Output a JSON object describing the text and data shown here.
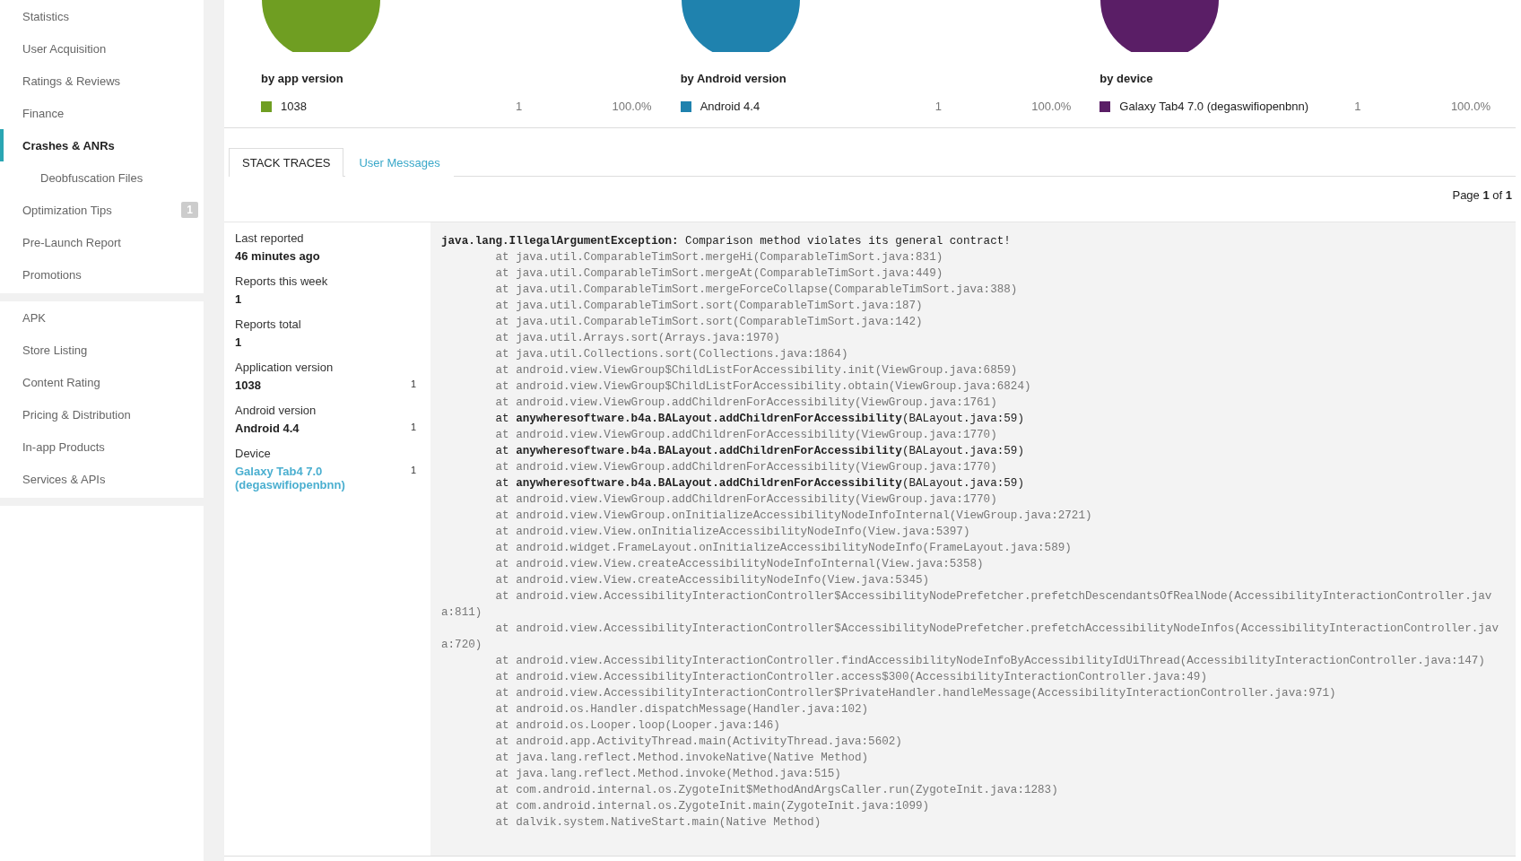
{
  "sidebar": {
    "sections": [
      {
        "items": [
          {
            "label": "Statistics",
            "selected": false
          },
          {
            "label": "User Acquisition",
            "selected": false
          },
          {
            "label": "Ratings & Reviews",
            "selected": false
          },
          {
            "label": "Finance",
            "selected": false
          },
          {
            "label": "Crashes & ANRs",
            "selected": true,
            "children": [
              {
                "label": "Deobfuscation Files",
                "selected": false
              }
            ]
          },
          {
            "label": "Optimization Tips",
            "selected": false,
            "badge": "1"
          },
          {
            "label": "Pre-Launch Report",
            "selected": false
          },
          {
            "label": "Promotions",
            "selected": false
          }
        ]
      },
      {
        "items": [
          {
            "label": "APK",
            "selected": false
          },
          {
            "label": "Store Listing",
            "selected": false
          },
          {
            "label": "Content Rating",
            "selected": false
          },
          {
            "label": "Pricing & Distribution",
            "selected": false
          },
          {
            "label": "In-app Products",
            "selected": false
          },
          {
            "label": "Services & APIs",
            "selected": false
          }
        ]
      }
    ]
  },
  "breakdowns": [
    {
      "title": "by app version",
      "legend": [
        {
          "label": "1038",
          "count": "1",
          "percent": "100.0%",
          "color": "#6f9e22"
        }
      ]
    },
    {
      "title": "by Android version",
      "legend": [
        {
          "label": "Android 4.4",
          "count": "1",
          "percent": "100.0%",
          "color": "#1f82ae"
        }
      ]
    },
    {
      "title": "by device",
      "legend": [
        {
          "label": "Galaxy Tab4 7.0 (degaswifiopenbnn)",
          "count": "1",
          "percent": "100.0%",
          "color": "#5a1e66"
        }
      ]
    }
  ],
  "tabs": [
    {
      "label": "STACK TRACES",
      "selected": true
    },
    {
      "label": "User Messages",
      "selected": false
    }
  ],
  "pagination": "Page **1** of **1**",
  "details": [
    {
      "label": "Last reported",
      "value": "46 minutes ago",
      "kind": "text"
    },
    {
      "label": "Reports this week",
      "value": "1",
      "kind": "text"
    },
    {
      "label": "Reports total",
      "value": "1",
      "kind": "text"
    },
    {
      "label": "Application version",
      "value": "1038",
      "count": "1",
      "kind": "text"
    },
    {
      "label": "Android version",
      "value": "Android 4.4",
      "count": "1",
      "kind": "text"
    },
    {
      "label": "Device",
      "value": "Galaxy Tab4 7.0 (degaswifiopenbnn)",
      "count": "1",
      "kind": "link"
    }
  ],
  "stack_trace": [
    {
      "kind": "exception",
      "text": "**java.lang.IllegalArgumentException:** Comparison method violates its general contract!"
    },
    {
      "kind": "frame",
      "text": "at java.util.ComparableTimSort.mergeHi(ComparableTimSort.java:831)"
    },
    {
      "kind": "frame",
      "text": "at java.util.ComparableTimSort.mergeAt(ComparableTimSort.java:449)"
    },
    {
      "kind": "frame",
      "text": "at java.util.ComparableTimSort.mergeForceCollapse(ComparableTimSort.java:388)"
    },
    {
      "kind": "frame",
      "text": "at java.util.ComparableTimSort.sort(ComparableTimSort.java:187)"
    },
    {
      "kind": "frame",
      "text": "at java.util.ComparableTimSort.sort(ComparableTimSort.java:142)"
    },
    {
      "kind": "frame",
      "text": "at java.util.Arrays.sort(Arrays.java:1970)"
    },
    {
      "kind": "frame",
      "text": "at java.util.Collections.sort(Collections.java:1864)"
    },
    {
      "kind": "frame",
      "text": "at android.view.ViewGroup$ChildListForAccessibility.init(ViewGroup.java:6859)"
    },
    {
      "kind": "frame",
      "text": "at android.view.ViewGroup$ChildListForAccessibility.obtain(ViewGroup.java:6824)"
    },
    {
      "kind": "frame",
      "text": "at android.view.ViewGroup.addChildrenForAccessibility(ViewGroup.java:1761)"
    },
    {
      "kind": "app_frame",
      "text": "at **anywheresoftware.b4a.BALayout.addChildrenForAccessibility**(BALayout.java:59)"
    },
    {
      "kind": "frame",
      "text": "at android.view.ViewGroup.addChildrenForAccessibility(ViewGroup.java:1770)"
    },
    {
      "kind": "app_frame",
      "text": "at **anywheresoftware.b4a.BALayout.addChildrenForAccessibility**(BALayout.java:59)"
    },
    {
      "kind": "frame",
      "text": "at android.view.ViewGroup.addChildrenForAccessibility(ViewGroup.java:1770)"
    },
    {
      "kind": "app_frame",
      "text": "at **anywheresoftware.b4a.BALayout.addChildrenForAccessibility**(BALayout.java:59)"
    },
    {
      "kind": "frame",
      "text": "at android.view.ViewGroup.addChildrenForAccessibility(ViewGroup.java:1770)"
    },
    {
      "kind": "frame",
      "text": "at android.view.ViewGroup.onInitializeAccessibilityNodeInfoInternal(ViewGroup.java:2721)"
    },
    {
      "kind": "frame",
      "text": "at android.view.View.onInitializeAccessibilityNodeInfo(View.java:5397)"
    },
    {
      "kind": "frame",
      "text": "at android.widget.FrameLayout.onInitializeAccessibilityNodeInfo(FrameLayout.java:589)"
    },
    {
      "kind": "frame",
      "text": "at android.view.View.createAccessibilityNodeInfoInternal(View.java:5358)"
    },
    {
      "kind": "frame",
      "text": "at android.view.View.createAccessibilityNodeInfo(View.java:5345)"
    },
    {
      "kind": "frame",
      "text": "at android.view.AccessibilityInteractionController$AccessibilityNodePrefetcher.prefetchDescendantsOfRealNode(AccessibilityInteractionController.java:811)"
    },
    {
      "kind": "frame",
      "text": "at android.view.AccessibilityInteractionController$AccessibilityNodePrefetcher.prefetchAccessibilityNodeInfos(AccessibilityInteractionController.java:720)"
    },
    {
      "kind": "frame",
      "text": "at android.view.AccessibilityInteractionController.findAccessibilityNodeInfoByAccessibilityIdUiThread(AccessibilityInteractionController.java:147)"
    },
    {
      "kind": "frame",
      "text": "at android.view.AccessibilityInteractionController.access$300(AccessibilityInteractionController.java:49)"
    },
    {
      "kind": "frame",
      "text": "at android.view.AccessibilityInteractionController$PrivateHandler.handleMessage(AccessibilityInteractionController.java:971)"
    },
    {
      "kind": "frame",
      "text": "at android.os.Handler.dispatchMessage(Handler.java:102)"
    },
    {
      "kind": "frame",
      "text": "at android.os.Looper.loop(Looper.java:146)"
    },
    {
      "kind": "frame",
      "text": "at android.app.ActivityThread.main(ActivityThread.java:5602)"
    },
    {
      "kind": "frame",
      "text": "at java.lang.reflect.Method.invokeNative(Native Method)"
    },
    {
      "kind": "frame",
      "text": "at java.lang.reflect.Method.invoke(Method.java:515)"
    },
    {
      "kind": "frame",
      "text": "at com.android.internal.os.ZygoteInit$MethodAndArgsCaller.run(ZygoteInit.java:1283)"
    },
    {
      "kind": "frame",
      "text": "at com.android.internal.os.ZygoteInit.main(ZygoteInit.java:1099)"
    },
    {
      "kind": "frame",
      "text": "at dalvik.system.NativeStart.main(Native Method)"
    }
  ]
}
